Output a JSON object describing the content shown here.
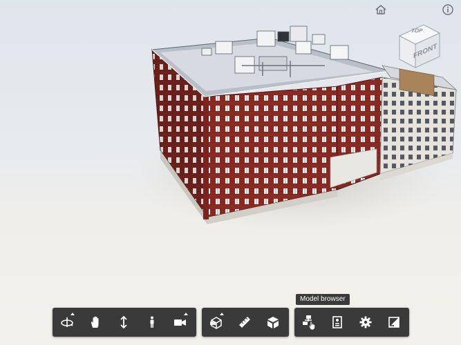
{
  "viewer": {
    "scene": "3d-building-model",
    "accent": "#3a3a3a",
    "toolbar_icon_color": "#ffffff"
  },
  "top_controls": {
    "home_icon": "home-icon",
    "info_icon": "info-icon"
  },
  "viewcube": {
    "top_label": "TOP",
    "front_label": "FRONT"
  },
  "tooltip": {
    "text": "Model browser"
  },
  "toolbar": {
    "navigation": [
      {
        "name": "orbit-icon",
        "has_flyout": true
      },
      {
        "name": "pan-icon",
        "has_flyout": false
      },
      {
        "name": "zoom-icon",
        "has_flyout": false
      },
      {
        "name": "first-person-icon",
        "has_flyout": false
      },
      {
        "name": "camera-icon",
        "has_flyout": true
      }
    ],
    "tools": [
      {
        "name": "section-icon",
        "has_flyout": true
      },
      {
        "name": "measure-icon",
        "has_flyout": false
      },
      {
        "name": "explode-icon",
        "has_flyout": false
      }
    ],
    "settings": [
      {
        "name": "model-browser-icon",
        "has_flyout": false
      },
      {
        "name": "properties-icon",
        "has_flyout": false
      },
      {
        "name": "settings-icon",
        "has_flyout": false
      },
      {
        "name": "fullscreen-icon",
        "has_flyout": false
      }
    ]
  }
}
